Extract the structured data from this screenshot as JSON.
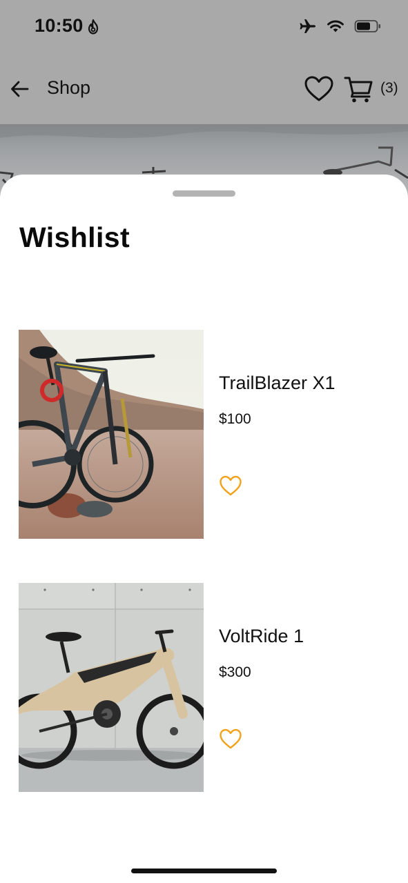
{
  "status_bar": {
    "time": "10:50",
    "icons": [
      "flame-icon",
      "airplane-icon",
      "wifi-icon",
      "battery-icon"
    ]
  },
  "nav": {
    "back_icon": "arrow-left-icon",
    "title": "Shop",
    "wishlist_icon": "heart-outline-icon",
    "cart_icon": "cart-icon",
    "cart_count": "(3)"
  },
  "sheet": {
    "title": "Wishlist"
  },
  "wishlist": [
    {
      "name": "TrailBlazer X1",
      "price": "$100",
      "image": "mountain-bike-photo",
      "favorite_icon": "heart-outline-icon"
    },
    {
      "name": "VoltRide 1",
      "price": "$300",
      "image": "electric-bike-photo",
      "favorite_icon": "heart-outline-icon"
    }
  ],
  "colors": {
    "overlay_dim": "#a9a9a9",
    "sheet_background": "#ffffff",
    "grabber": "#b3b3b3",
    "heart_accent": "#f0a21a",
    "text_primary": "#111111"
  }
}
